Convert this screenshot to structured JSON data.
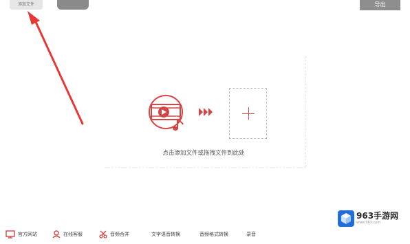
{
  "toolbar": {
    "add_file_label": "添加文件",
    "second_label": "",
    "export_label": "导出"
  },
  "main": {
    "drop_hint": "点击添加文件或拖拽文件到此处"
  },
  "bottom": {
    "items": [
      {
        "label": "官方网站",
        "icon": "monitor-icon"
      },
      {
        "label": "在线客服",
        "icon": "person-icon"
      },
      {
        "label": "音频合并",
        "icon": "scissors-icon"
      },
      {
        "label": "文字语音转换",
        "icon": ""
      },
      {
        "label": "音频格式转换",
        "icon": ""
      },
      {
        "label": "录音",
        "icon": ""
      }
    ]
  },
  "watermark": {
    "title": "963手游网",
    "url": "www.963.com"
  },
  "colors": {
    "accent": "#d64545",
    "annotation_arrow": "#e53935"
  }
}
